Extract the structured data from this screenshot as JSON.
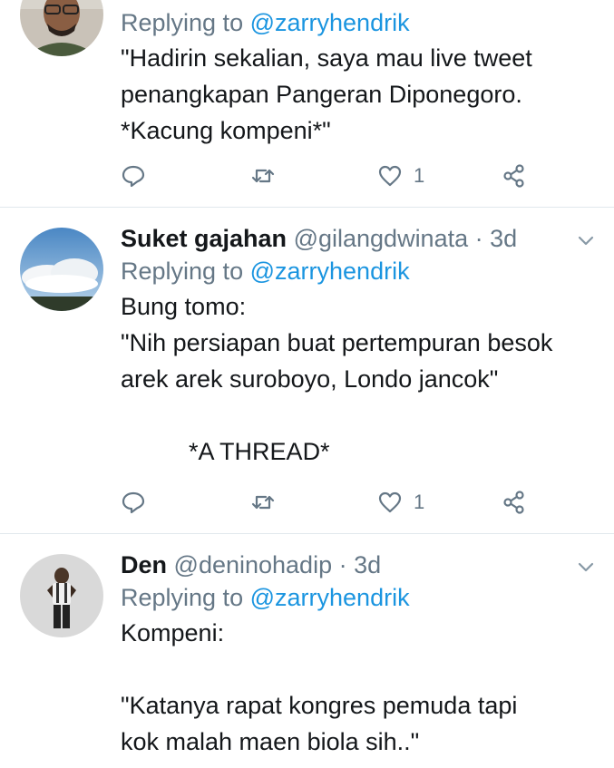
{
  "tweets": [
    {
      "reply_prefix": "Replying to",
      "reply_mention": "@zarryhendrik",
      "text": "\"Hadirin sekalian, saya mau live tweet\npenangkapan Pangeran Diponegoro.\n*Kacung kompeni*\"",
      "like_count": "1"
    },
    {
      "name": "Suket gajahan",
      "handle": "@gilangdwinata",
      "separator": "·",
      "time": "3d",
      "reply_prefix": "Replying to",
      "reply_mention": "@zarryhendrik",
      "text": "Bung tomo:\n\"Nih persiapan buat pertempuran besok\narek arek suroboyo, Londo jancok\"\n\n          *A THREAD*",
      "like_count": "1"
    },
    {
      "name": "Den",
      "handle": "@deninohadip",
      "separator": "·",
      "time": "3d",
      "reply_prefix": "Replying to",
      "reply_mention": "@zarryhendrik",
      "text": "Kompeni:\n\n\"Katanya rapat kongres pemuda tapi\nkok malah maen biola sih..\""
    }
  ],
  "colors": {
    "text": "#14171a",
    "secondary": "#657786",
    "link": "#1b95e0",
    "divider": "#e1e8ed"
  },
  "icons": [
    "reply-icon",
    "retweet-icon",
    "like-icon",
    "share-icon",
    "chevron-down-icon"
  ]
}
